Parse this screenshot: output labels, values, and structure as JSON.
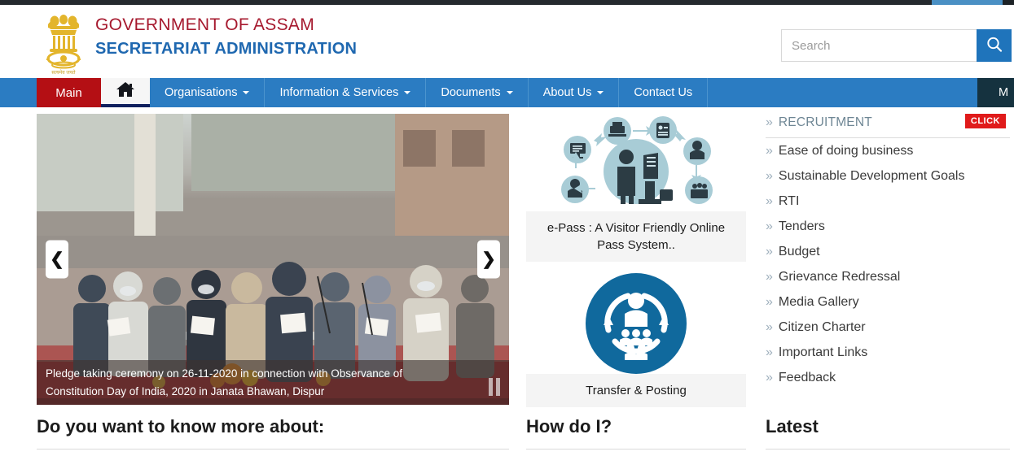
{
  "header": {
    "emblem_icon": "ashoka-emblem-icon",
    "title_line1": "GOVERNMENT OF ASSAM",
    "title_line2": "SECRETARIAT ADMINISTRATION",
    "colors": {
      "gov_red": "#a6192e",
      "sec_blue": "#1f68b0",
      "emblem_gold": "#e8b931"
    }
  },
  "search": {
    "placeholder": "Search",
    "value": "",
    "button_icon": "search-icon",
    "button_color": "#1f74bb"
  },
  "nav": {
    "main_label": "Main",
    "home_icon": "home-icon",
    "items": [
      {
        "label": "Organisations",
        "has_caret": true
      },
      {
        "label": "Information & Services",
        "has_caret": true
      },
      {
        "label": "Documents",
        "has_caret": true
      },
      {
        "label": "About Us",
        "has_caret": true
      },
      {
        "label": "Contact Us",
        "has_caret": false
      }
    ],
    "right_partial_label": "M",
    "colors": {
      "bar": "#2b7cc2",
      "main": "#b40f14",
      "active_underline": "#10205e",
      "right_block": "#15323f"
    }
  },
  "carousel": {
    "caption_line1": "Pledge taking ceremony on 26-11-2020 in connection with Observance of",
    "caption_line2": "Constitution Day of India, 2020 in Janata Bhawan, Dispur",
    "prev_icon": "chevron-left-icon",
    "next_icon": "chevron-right-icon",
    "pause_icon": "pause-icon"
  },
  "promos": [
    {
      "art_icon": "epass-workflow-icon",
      "label": "e-Pass : A Visitor Friendly Online Pass System.."
    },
    {
      "art_icon": "transfer-posting-icon",
      "label": "Transfer & Posting"
    }
  ],
  "quick_links": [
    {
      "label": "RECRUITMENT",
      "muted": true,
      "badge": "CLICK",
      "divider": true
    },
    {
      "label": "Ease of doing business",
      "muted": false,
      "badge": null,
      "divider": false
    },
    {
      "label": "Sustainable Development Goals",
      "muted": false,
      "badge": null,
      "divider": false
    },
    {
      "label": "RTI",
      "muted": false,
      "badge": null,
      "divider": false
    },
    {
      "label": "Tenders",
      "muted": false,
      "badge": null,
      "divider": false
    },
    {
      "label": "Budget",
      "muted": false,
      "badge": null,
      "divider": false
    },
    {
      "label": "Grievance Redressal",
      "muted": false,
      "badge": null,
      "divider": false
    },
    {
      "label": "Media Gallery",
      "muted": false,
      "badge": null,
      "divider": false
    },
    {
      "label": "Citizen Charter",
      "muted": false,
      "badge": null,
      "divider": false
    },
    {
      "label": "Important Links",
      "muted": false,
      "badge": null,
      "divider": false
    },
    {
      "label": "Feedback",
      "muted": false,
      "badge": null,
      "divider": false
    }
  ],
  "sections": {
    "left_heading": "Do you want to know more about:",
    "middle_heading": "How do I?",
    "right_heading": "Latest"
  }
}
